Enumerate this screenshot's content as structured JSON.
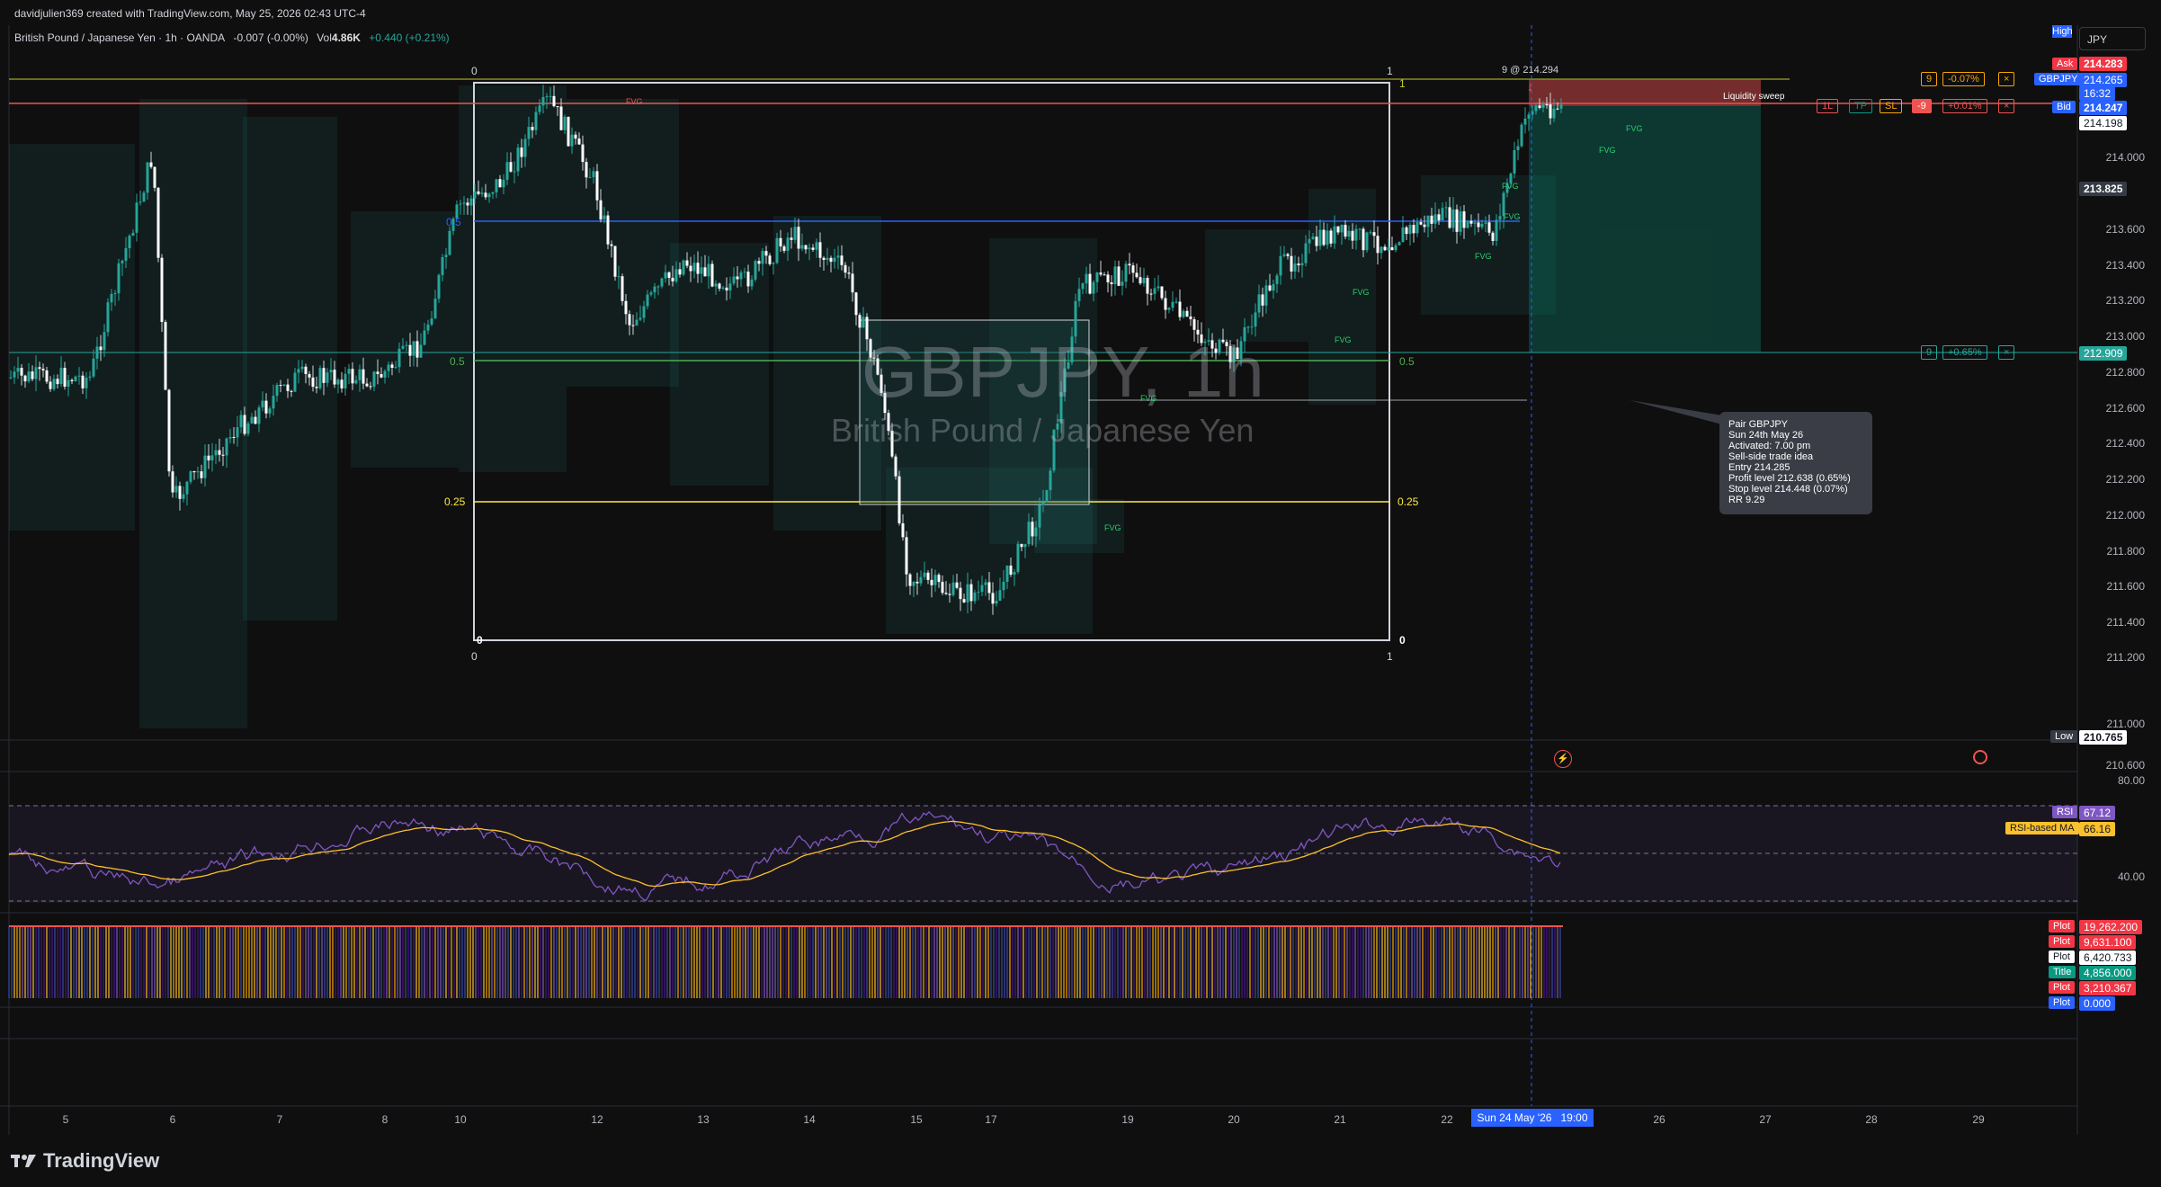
{
  "header": {
    "credit": "davidjulien369 created with TradingView.com, May 25, 2026 02:43 UTC-4",
    "currency_button": "JPY",
    "high_label": "High",
    "low_label": "Low"
  },
  "symbol": {
    "name": "British Pound / Japanese Yen · 1h · OANDA",
    "change": "-0.007 (-0.00%)",
    "vol_label": "Vol",
    "vol_value": "4.86K",
    "change2": "+0.440 (+0.21%)"
  },
  "watermark": {
    "title": "GBPJPY, 1h",
    "subtitle": "British Pound / Japanese Yen"
  },
  "price_axis": {
    "labels": [
      "214.000",
      "213.600",
      "213.400",
      "213.200",
      "213.000",
      "212.800",
      "212.600",
      "212.400",
      "212.200",
      "212.000",
      "211.800",
      "211.600",
      "211.400",
      "211.200",
      "211.000",
      "210.600"
    ],
    "ask_label": "Ask",
    "ask_value": "214.283",
    "symbol_tag": "GBPJPY",
    "last_value": "214.265",
    "countdown": "16:32",
    "bid_label": "Bid",
    "bid_value": "214.247",
    "tag_214198": "214.198",
    "tag_213825": "213.825",
    "tag_212909": "212.909",
    "low_value": "210.765",
    "top_hidden": "210.600"
  },
  "orders": {
    "top_qty": "9",
    "top_pct": "-0.07%",
    "mid_qty": "-9",
    "mid_pct": "+0.01%",
    "mid_1l": "1L",
    "tp": "TP",
    "sl": "SL",
    "low_qty": "9",
    "low_pct": "+0.65%",
    "at_label": "9 @ 214.294",
    "close_icon": "×"
  },
  "fib": {
    "top": "1",
    "upper": "0.5",
    "mid": "0.5",
    "quarter": "0.25",
    "bottom": "0",
    "corner_tl": "0",
    "corner_tr": "1",
    "corner_bl": "0",
    "corner_br": "1"
  },
  "annotations": {
    "liquidity": "Liquidity sweep",
    "fvg": "FVG"
  },
  "info_box": {
    "lines": [
      "Pair GBPJPY",
      "Sun 24th May 26",
      "Activated: 7.00 pm",
      "Sell-side trade idea",
      "Entry 214.285",
      "Profit level 212.638 (0.65%)",
      "Stop level 214.448 (0.07%)",
      "RR 9.29"
    ]
  },
  "rsi": {
    "label": "RSI",
    "value": "67.12",
    "ma_label": "RSI-based MA",
    "ma_value": "66.16",
    "axis_80": "80.00",
    "axis_40": "40.00"
  },
  "plots": [
    {
      "label": "Plot",
      "value": "19,262.200",
      "color": "#f23645"
    },
    {
      "label": "Plot",
      "value": "9,631.100",
      "color": "#f23645"
    },
    {
      "label": "Plot",
      "value": "6,420.733",
      "color": "#ffffff"
    },
    {
      "label": "Title",
      "value": "4,856.000",
      "color": "#089981"
    },
    {
      "label": "Plot",
      "value": "3,210.367",
      "color": "#f23645"
    },
    {
      "label": "Plot",
      "value": "0.000",
      "color": "#2962ff"
    }
  ],
  "time_axis": {
    "labels": [
      "5",
      "6",
      "7",
      "8",
      "10",
      "12",
      "13",
      "14",
      "15",
      "17",
      "19",
      "20",
      "21",
      "22",
      "26",
      "27",
      "28",
      "29"
    ],
    "cursor_label": "Sun 24 May '26   19:00"
  },
  "footer": {
    "brand": "TradingView"
  },
  "colors": {
    "bg": "#0f0f0f",
    "up": "#26a69a",
    "down": "#ef5350",
    "fib_blue": "#2962ff",
    "fib_green": "#4caf50",
    "fib_yellow": "#ffeb3b",
    "rsi": "#7e57c2"
  }
}
